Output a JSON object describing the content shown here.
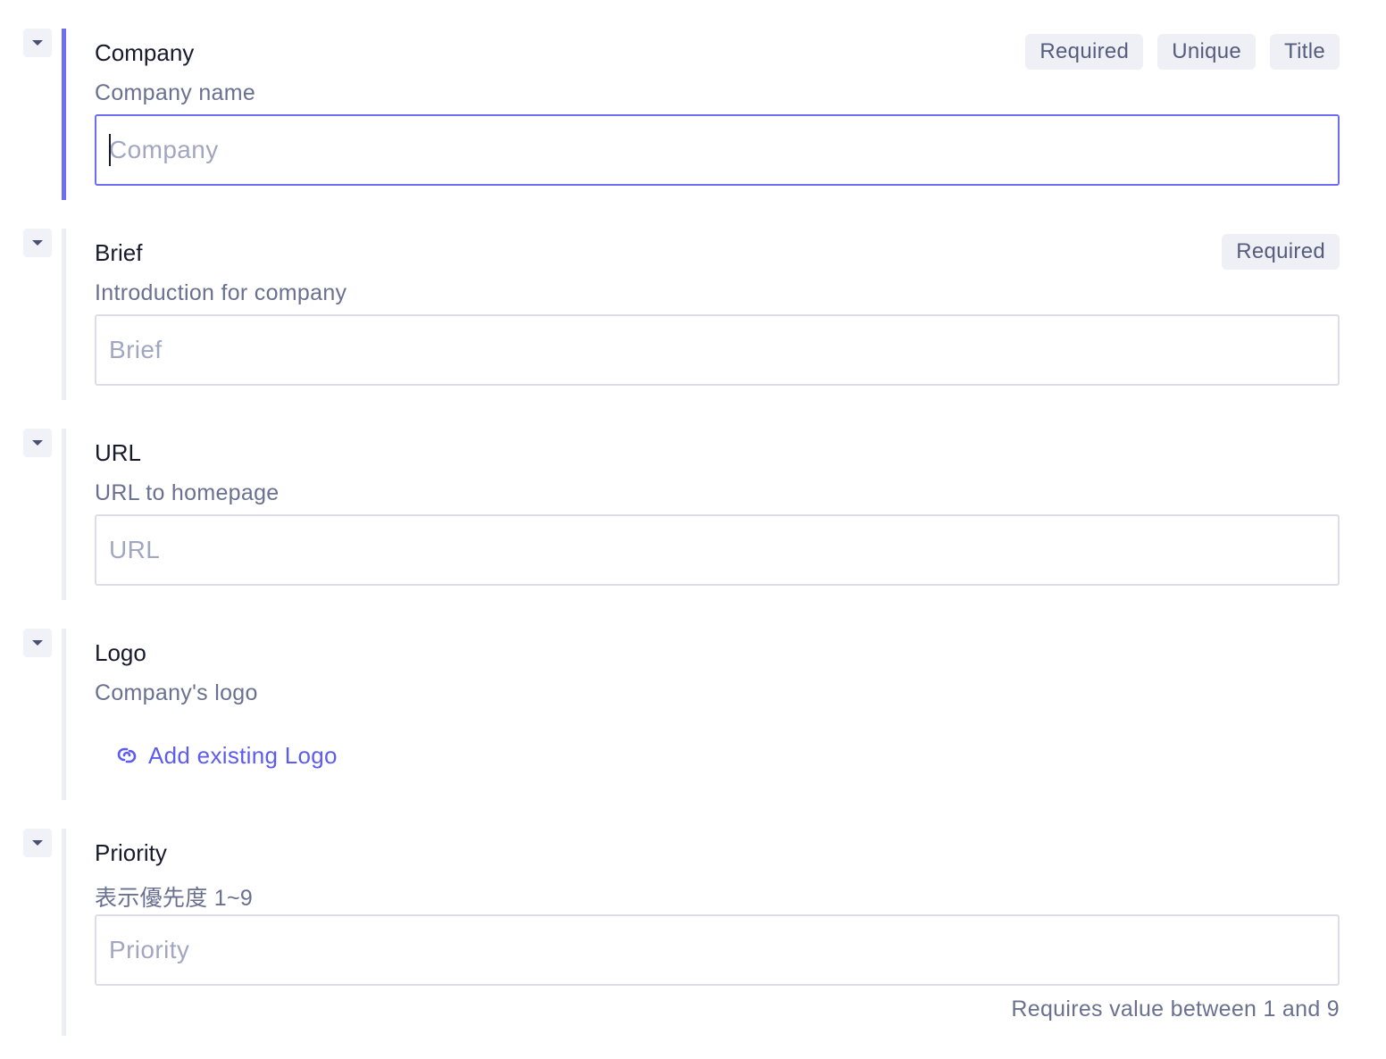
{
  "fields": {
    "company": {
      "label": "Company",
      "description": "Company name",
      "placeholder": "Company",
      "value": "",
      "badges": [
        "Required",
        "Unique",
        "Title"
      ]
    },
    "brief": {
      "label": "Brief",
      "description": "Introduction for company",
      "placeholder": "Brief",
      "value": "",
      "badges": [
        "Required"
      ]
    },
    "url": {
      "label": "URL",
      "description": "URL to homepage",
      "placeholder": "URL",
      "value": ""
    },
    "logo": {
      "label": "Logo",
      "description": "Company's logo",
      "add_link_label": "Add existing Logo"
    },
    "priority": {
      "label": "Priority",
      "description": "表示優先度 1~9",
      "placeholder": "Priority",
      "value": "",
      "hint": "Requires value between 1 and 9"
    }
  },
  "colors": {
    "accent": "#6d6cf2",
    "link": "#5c5cf0",
    "label": "#171a2c",
    "muted": "#6a7190",
    "badge_bg": "#eff0f6"
  },
  "icons": {
    "collapse": "caret-down-icon",
    "link": "link-icon"
  }
}
